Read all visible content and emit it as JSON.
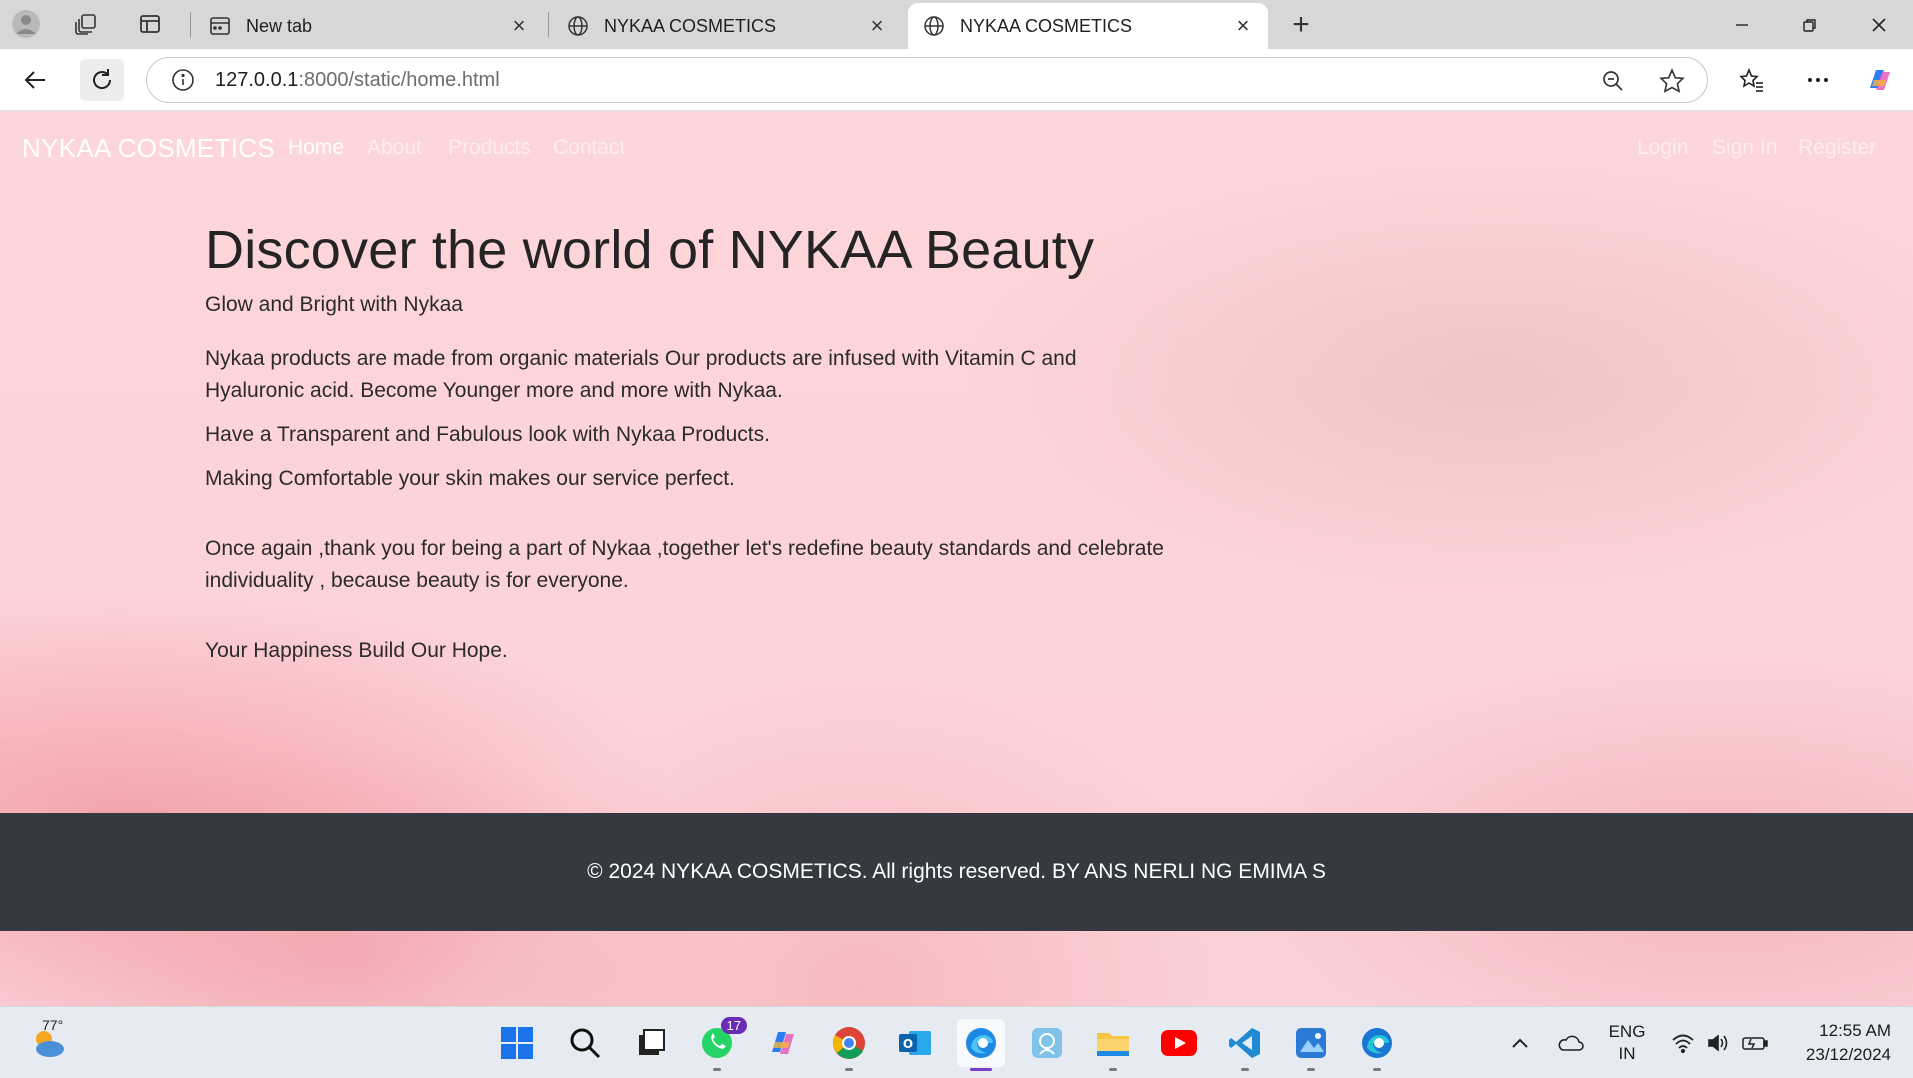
{
  "browser": {
    "tabs": [
      {
        "label": "New tab"
      },
      {
        "label": "NYKAA COSMETICS"
      },
      {
        "label": "NYKAA COSMETICS"
      }
    ],
    "url_host": "127.0.0.1",
    "url_rest": ":8000/static/home.html"
  },
  "site": {
    "brand": "NYKAA COSMETICS",
    "nav": [
      "Home",
      "About",
      "Products",
      "Contact"
    ],
    "auth": [
      "Login",
      "Sign In",
      "Register"
    ],
    "headline": "Discover the world of NYKAA Beauty",
    "tagline": "Glow and Bright with Nykaa",
    "para1": "Nykaa products are made from organic materials Our products are infused with Vitamin C and Hyaluronic acid. Become Younger more and more with Nykaa.",
    "para2": "Have a Transparent and Fabulous look with Nykaa Products.",
    "para3": "Making Comfortable your skin makes our service perfect.",
    "para4": "Once again ,thank you for being a part of Nykaa ,together let's redefine beauty standards and celebrate individuality , because beauty is for everyone.",
    "para5": "Your Happiness Build Our Hope.",
    "footer": "© 2024 NYKAA COSMETICS. All rights reserved. BY ANS NERLI NG EMIMA S"
  },
  "taskbar": {
    "weather": "77°",
    "whatsapp_badge": "17",
    "lang_top": "ENG",
    "lang_bottom": "IN",
    "time": "12:55 AM",
    "date": "23/12/2024"
  }
}
